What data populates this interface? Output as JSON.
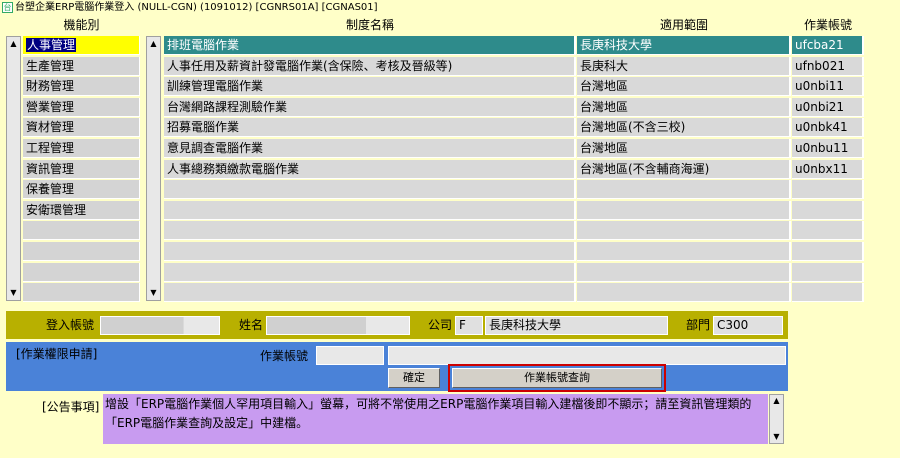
{
  "window": {
    "title": "台塑企業ERP電腦作業登入 (NULL-CGN) (1091012) [CGNRS01A] [CGNAS01]"
  },
  "headers": {
    "function": "機能別",
    "system_name": "制度名稱",
    "scope": "適用範圍",
    "account": "作業帳號"
  },
  "functions": [
    {
      "label": "人事管理",
      "active": true
    },
    {
      "label": "生產管理"
    },
    {
      "label": "財務管理"
    },
    {
      "label": "營業管理"
    },
    {
      "label": "資材管理"
    },
    {
      "label": "工程管理"
    },
    {
      "label": "資訊管理"
    },
    {
      "label": "保養管理"
    },
    {
      "label": "安衛環管理"
    },
    {
      "label": ""
    },
    {
      "label": ""
    },
    {
      "label": ""
    },
    {
      "label": ""
    }
  ],
  "systems": [
    {
      "name": "排班電腦作業",
      "scope": "長庚科技大學",
      "account": "ufcba21",
      "selected": true
    },
    {
      "name": "人事任用及薪資計發電腦作業(含保險、考核及晉級等)",
      "scope": "長庚科大",
      "account": "ufnb021"
    },
    {
      "name": "訓練管理電腦作業",
      "scope": "台灣地區",
      "account": "u0nbi11"
    },
    {
      "name": "台灣網路課程測驗作業",
      "scope": "台灣地區",
      "account": "u0nbi21"
    },
    {
      "name": "招募電腦作業",
      "scope": "台灣地區(不含三校)",
      "account": "u0nbk41"
    },
    {
      "name": "意見調查電腦作業",
      "scope": "台灣地區",
      "account": "u0nbu11"
    },
    {
      "name": "人事總務類繳款電腦作業",
      "scope": "台灣地區(不含輔商海運)",
      "account": "u0nbx11"
    },
    {
      "name": "",
      "scope": "",
      "account": ""
    },
    {
      "name": "",
      "scope": "",
      "account": ""
    },
    {
      "name": "",
      "scope": "",
      "account": ""
    },
    {
      "name": "",
      "scope": "",
      "account": ""
    },
    {
      "name": "",
      "scope": "",
      "account": ""
    },
    {
      "name": "",
      "scope": "",
      "account": ""
    }
  ],
  "login": {
    "account_label": "登入帳號",
    "account_value": "",
    "name_label": "姓名",
    "name_value": "",
    "company_label": "公司",
    "company_code": "F",
    "company_name": "長庚科技大學",
    "dept_label": "部門",
    "dept_value": "C300"
  },
  "permission": {
    "title": "[作業權限申請]",
    "account_label": "作業帳號",
    "account_value": "",
    "description_value": "",
    "confirm_label": "確定",
    "query_label": "作業帳號查詢"
  },
  "notice": {
    "label": "[公告事項]",
    "text": "增設「ERP電腦作業個人罕用項目輸入」螢幕，可將不常使用之ERP電腦作業項目輸入建檔後即不顯示；請至資訊管理類的「ERP電腦作業查詢及設定」中建檔。"
  },
  "colors": {
    "background": "#ffffc8",
    "selected_row": "#2e8b8b",
    "active_function": "#ffff00",
    "login_bar": "#b8b000",
    "permission_bar": "#4a82d8",
    "notice_body": "#c89bf0",
    "highlight": "#cc0000"
  }
}
